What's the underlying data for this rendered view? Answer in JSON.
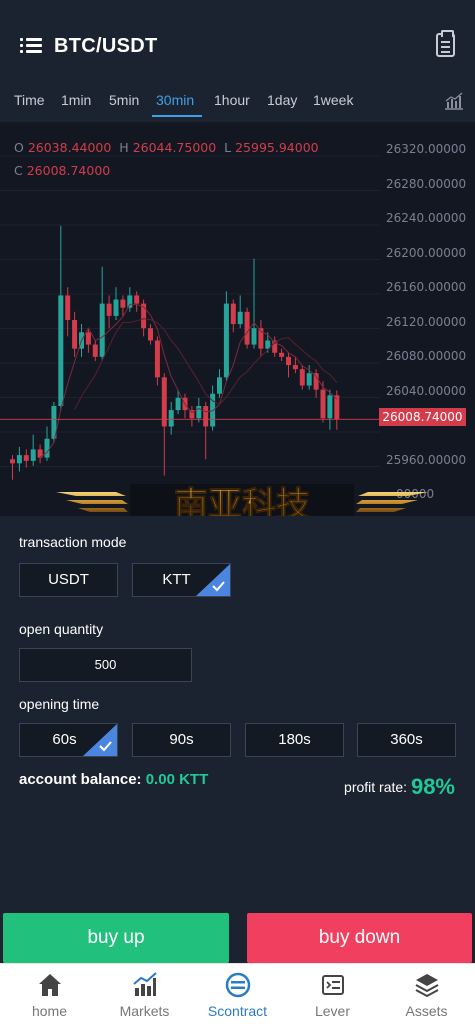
{
  "header": {
    "title": "BTC/USDT",
    "menu_icon": "hamburger-icon",
    "action_icon": "clipboard-icon"
  },
  "tabs": [
    {
      "label": "Time"
    },
    {
      "label": "1min"
    },
    {
      "label": "5min"
    },
    {
      "label": "30min",
      "active": true
    },
    {
      "label": "1hour"
    },
    {
      "label": "1day"
    },
    {
      "label": "1week"
    }
  ],
  "chart": {
    "ohlc": {
      "o_key": "O",
      "o": "26038.44000",
      "h_key": "H",
      "h": "26044.75000",
      "l_key": "L",
      "l": "25995.94000",
      "c_key": "C",
      "c": "26008.74000"
    },
    "price_labels": [
      "26320.00000",
      "26280.00000",
      "26240.00000",
      "26200.00000",
      "26160.00000",
      "26120.00000",
      "26080.00000",
      "26040.00000",
      "25960.00000",
      "00000"
    ],
    "current_price": "26008.74000",
    "watermark_text": "南亚科技"
  },
  "chart_data": {
    "type": "candlestick",
    "ylim": [
      25920,
      26340
    ],
    "current_price": 26008.74,
    "candles": [
      [
        25960,
        25955,
        25965,
        25935
      ],
      [
        25955,
        25965,
        25975,
        25945
      ],
      [
        25965,
        25958,
        25972,
        25950
      ],
      [
        25958,
        25972,
        25990,
        25952
      ],
      [
        25972,
        25962,
        25978,
        25955
      ],
      [
        25962,
        25985,
        26000,
        25958
      ],
      [
        25985,
        26025,
        26030,
        25980
      ],
      [
        26025,
        26160,
        26245,
        26020
      ],
      [
        26160,
        26130,
        26170,
        26110
      ],
      [
        26130,
        26095,
        26140,
        26085
      ],
      [
        26095,
        26115,
        26125,
        26085
      ],
      [
        26115,
        26100,
        26120,
        26090
      ],
      [
        26100,
        26085,
        26105,
        26080
      ],
      [
        26085,
        26150,
        26195,
        26080
      ],
      [
        26150,
        26135,
        26160,
        26120
      ],
      [
        26135,
        26155,
        26170,
        26130
      ],
      [
        26155,
        26145,
        26160,
        26135
      ],
      [
        26145,
        26160,
        26170,
        26140
      ],
      [
        26160,
        26150,
        26165,
        26140
      ],
      [
        26150,
        26120,
        26155,
        26110
      ],
      [
        26120,
        26105,
        26125,
        26100
      ],
      [
        26105,
        26060,
        26110,
        26050
      ],
      [
        26060,
        26000,
        26065,
        25940
      ],
      [
        26000,
        26020,
        26030,
        25990
      ],
      [
        26020,
        26035,
        26045,
        26015
      ],
      [
        26035,
        26020,
        26040,
        26010
      ],
      [
        26020,
        26010,
        26025,
        26000
      ],
      [
        26010,
        26025,
        26035,
        26005
      ],
      [
        26025,
        26000,
        26030,
        25960
      ],
      [
        26000,
        26040,
        26050,
        25995
      ],
      [
        26040,
        26060,
        26070,
        26035
      ],
      [
        26060,
        26150,
        26165,
        26055
      ],
      [
        26150,
        26125,
        26155,
        26115
      ],
      [
        26125,
        26140,
        26160,
        26120
      ],
      [
        26140,
        26100,
        26145,
        26095
      ],
      [
        26100,
        26120,
        26205,
        26095
      ],
      [
        26120,
        26095,
        26130,
        26085
      ],
      [
        26095,
        26105,
        26115,
        26090
      ],
      [
        26105,
        26090,
        26110,
        26085
      ],
      [
        26090,
        26085,
        26095,
        26080
      ],
      [
        26085,
        26075,
        26090,
        26060
      ],
      [
        26075,
        26070,
        26085,
        26065
      ],
      [
        26070,
        26050,
        26075,
        26045
      ],
      [
        26050,
        26065,
        26075,
        26045
      ],
      [
        26065,
        26045,
        26070,
        26035
      ],
      [
        26045,
        26010,
        26055,
        26005
      ],
      [
        26010,
        26038,
        26045,
        25996
      ],
      [
        26038,
        26009,
        26044,
        25996
      ]
    ]
  },
  "form": {
    "transaction_mode_label": "transaction mode",
    "modes": [
      {
        "label": "USDT"
      },
      {
        "label": "KTT",
        "selected": true
      }
    ],
    "open_quantity_label": "open quantity",
    "quantity_value": "500",
    "opening_time_label": "opening time",
    "times": [
      {
        "label": "60s",
        "selected": true
      },
      {
        "label": "90s"
      },
      {
        "label": "180s"
      },
      {
        "label": "360s"
      }
    ],
    "balance_label": "account balance:",
    "balance_value": "0.00 KTT",
    "profit_label": "profit rate:",
    "profit_value": "98%"
  },
  "actions": {
    "buy_up": "buy up",
    "buy_down": "buy down"
  },
  "nav": [
    {
      "label": "home",
      "icon": "home-icon"
    },
    {
      "label": "Markets",
      "icon": "chart-icon"
    },
    {
      "label": "Scontract",
      "icon": "contract-icon",
      "active": true
    },
    {
      "label": "Lever",
      "icon": "lever-icon"
    },
    {
      "label": "Assets",
      "icon": "layers-icon"
    }
  ],
  "colors": {
    "up": "#22c07d",
    "down": "#f03f5f",
    "accent": "#3ea0e6",
    "candle_up": "#26a69a",
    "candle_down": "#d23c4b"
  }
}
